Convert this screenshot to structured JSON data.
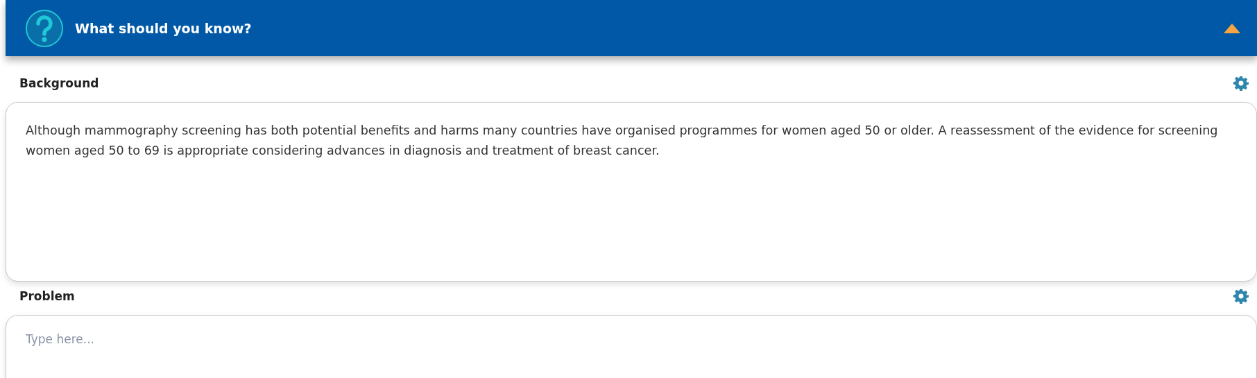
{
  "panel": {
    "title": "What should you know?",
    "expanded": true
  },
  "sections": [
    {
      "label": "Background",
      "kind": "text",
      "value": "Although mammography screening has both potential benefits and harms many countries have organised programmes for women aged 50 or older. A reassessment of the evidence for screening women aged 50 to 69 is appropriate considering advances in diagnosis and treatment of breast cancer."
    },
    {
      "label": "Problem",
      "kind": "input",
      "placeholder": "Type here..."
    }
  ]
}
